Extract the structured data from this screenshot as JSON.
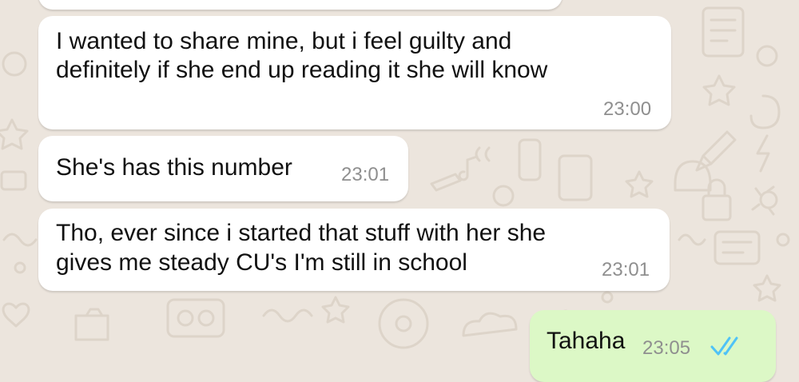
{
  "chat": {
    "messages": [
      {
        "direction": "incoming",
        "lines": [
          "I wanted to share mine, but i feel guilty and",
          "definitely if she end up reading it she will know"
        ],
        "time": "23:00"
      },
      {
        "direction": "incoming",
        "lines": [
          "She's has this number"
        ],
        "time": "23:01"
      },
      {
        "direction": "incoming",
        "lines": [
          "Tho, ever since i started that stuff with her she",
          "gives me steady CU's I'm still in school"
        ],
        "time": "23:01"
      },
      {
        "direction": "outgoing",
        "lines": [
          "Tahaha"
        ],
        "time": "23:05",
        "status": "read"
      }
    ]
  },
  "colors": {
    "wallpaper": "#ece5dd",
    "incoming_bubble": "#ffffff",
    "outgoing_bubble": "#dcf8c6",
    "timestamp": "#8f8f8f",
    "read_ticks": "#4fc3f7"
  },
  "icons": {
    "read_status": "double-check-icon"
  }
}
